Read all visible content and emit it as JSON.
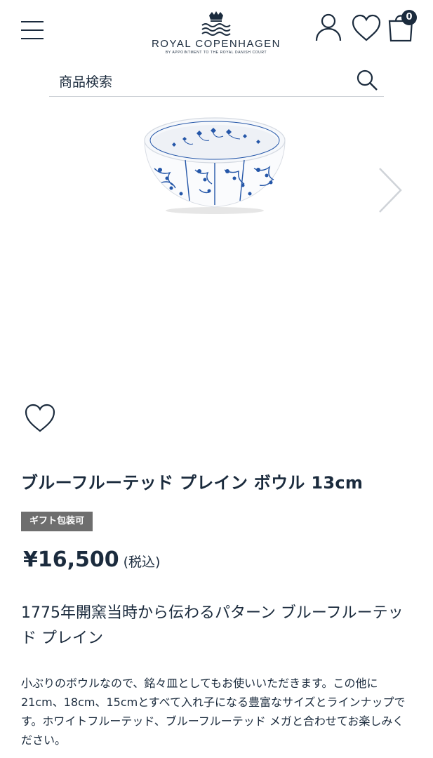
{
  "header": {
    "logo_name": "ROYAL COPENHAGEN",
    "logo_subtitle": "BY APPOINTMENT TO THE ROYAL DANISH COURT",
    "cart_count": "0",
    "icons": [
      "menu-icon",
      "user-icon",
      "heart-icon",
      "cart-icon"
    ]
  },
  "search": {
    "placeholder": "商品検索"
  },
  "product": {
    "title": "ブルーフルーテッド プレイン ボウル 13cm",
    "gift_badge": "ギフト包装可",
    "price": "¥16,500",
    "tax_note": "(税込)",
    "subtitle": "1775年開窯当時から伝わるパターン ブルーフルーテッド プレイン",
    "description": "小ぶりのボウルなので、銘々皿としてもお使いいただきます。この他に21cm、18cm、15cmとすべて入れ子になる豊富なサイズとラインナップです。ホワイトフルーテッド、ブルーフルーテッド メガと合わせてお楽しみください。"
  },
  "colors": {
    "text": "#1b2b3d",
    "badge_bg": "#6e6e6e",
    "pattern_blue": "#2456a8"
  }
}
